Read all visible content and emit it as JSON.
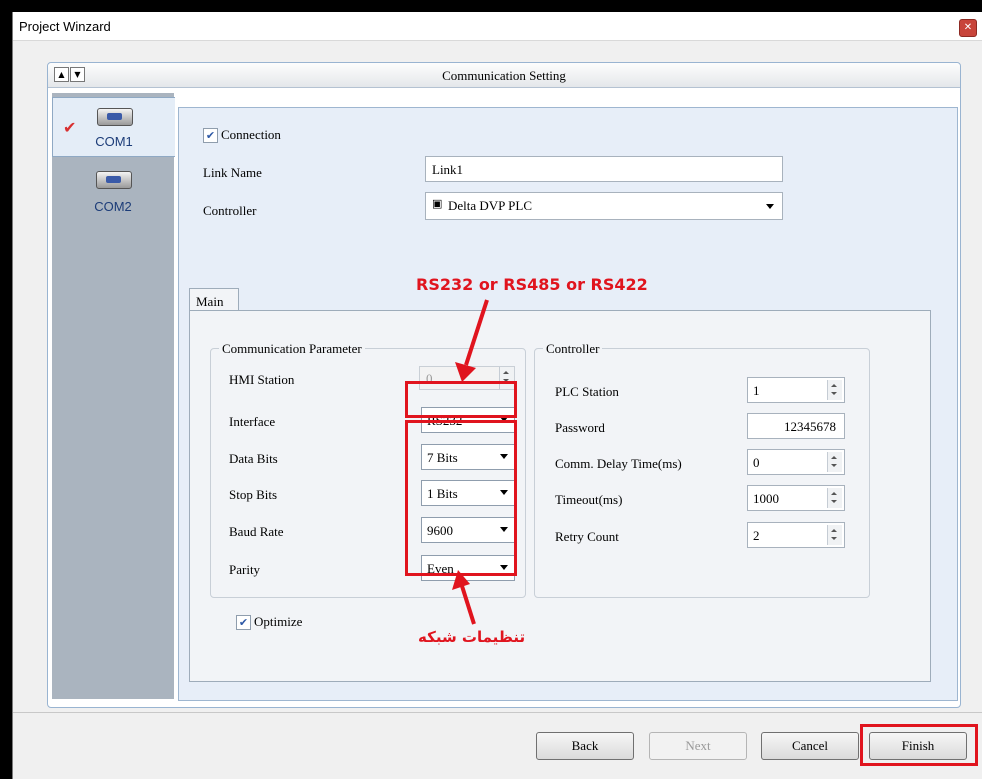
{
  "window": {
    "title": "Project Winzard",
    "close_icon": "x-icon"
  },
  "panel": {
    "title": "Communication Setting",
    "scroll_up_glyph": "▲",
    "scroll_down_glyph": "▼"
  },
  "ports": [
    {
      "label": "COM1",
      "selected": true
    },
    {
      "label": "COM2",
      "selected": false
    }
  ],
  "form": {
    "connection_label": "Connection",
    "connection_checked": true,
    "link_name_label": "Link Name",
    "link_name_value": "Link1",
    "controller_label": "Controller",
    "controller_value": "Delta DVP PLC"
  },
  "tab": {
    "label": "Main"
  },
  "comm_group": {
    "legend": "Communication Parameter",
    "hmi_station_label": "HMI Station",
    "hmi_station_value": "0",
    "interface_label": "Interface",
    "interface_value": "RS232",
    "data_bits_label": "Data Bits",
    "data_bits_value": "7 Bits",
    "stop_bits_label": "Stop Bits",
    "stop_bits_value": "1 Bits",
    "baud_rate_label": "Baud Rate",
    "baud_rate_value": "9600",
    "parity_label": "Parity",
    "parity_value": "Even"
  },
  "controller_group": {
    "legend": "Controller",
    "plc_station_label": "PLC Station",
    "plc_station_value": "1",
    "password_label": "Password",
    "password_value": "12345678",
    "comm_delay_label": "Comm. Delay Time(ms)",
    "comm_delay_value": "0",
    "timeout_label": "Timeout(ms)",
    "timeout_value": "1000",
    "retry_label": "Retry Count",
    "retry_value": "2"
  },
  "optimize": {
    "label": "Optimize",
    "checked": true
  },
  "annotations": {
    "top": "RS232 or RS485 or RS422",
    "bottom": "تنظیمات شبکه",
    "color": "#e0141e"
  },
  "buttons": {
    "back": "Back",
    "next": "Next",
    "cancel": "Cancel",
    "finish": "Finish"
  }
}
